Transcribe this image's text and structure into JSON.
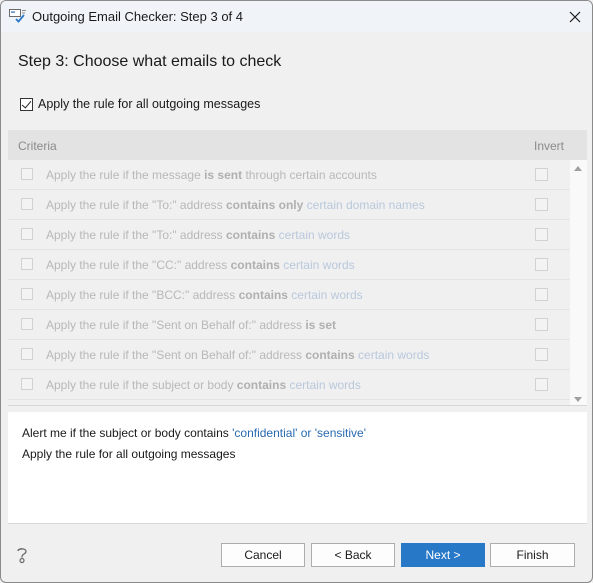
{
  "window": {
    "title": "Outgoing Email Checker: Step 3 of 4",
    "icon": "email-check-icon",
    "close_icon": "close-icon"
  },
  "step_heading": "Step 3: Choose what emails to check",
  "apply_all": {
    "label": "Apply the rule for all outgoing messages",
    "checked": true
  },
  "grid": {
    "columns": {
      "criteria": "Criteria",
      "invert": "Invert"
    },
    "rows": [
      {
        "parts": [
          {
            "t": "Apply the rule if the message ",
            "s": "normal"
          },
          {
            "t": "is sent",
            "s": "bold"
          },
          {
            "t": " through certain accounts",
            "s": "normal"
          }
        ],
        "checked": false,
        "invert": false,
        "enabled": false
      },
      {
        "parts": [
          {
            "t": "Apply the rule if the \"To:\" address ",
            "s": "normal"
          },
          {
            "t": "contains only",
            "s": "bold"
          },
          {
            "t": " ",
            "s": "normal"
          },
          {
            "t": "certain domain names",
            "s": "link"
          }
        ],
        "checked": false,
        "invert": false,
        "enabled": false
      },
      {
        "parts": [
          {
            "t": "Apply the rule if the \"To:\" address ",
            "s": "normal"
          },
          {
            "t": "contains",
            "s": "bold"
          },
          {
            "t": " ",
            "s": "normal"
          },
          {
            "t": "certain words",
            "s": "link"
          }
        ],
        "checked": false,
        "invert": false,
        "enabled": false
      },
      {
        "parts": [
          {
            "t": "Apply the rule if the \"CC:\" address ",
            "s": "normal"
          },
          {
            "t": "contains",
            "s": "bold"
          },
          {
            "t": " ",
            "s": "normal"
          },
          {
            "t": "certain words",
            "s": "link"
          }
        ],
        "checked": false,
        "invert": false,
        "enabled": false
      },
      {
        "parts": [
          {
            "t": "Apply the rule if the \"BCC:\" address ",
            "s": "normal"
          },
          {
            "t": "contains",
            "s": "bold"
          },
          {
            "t": " ",
            "s": "normal"
          },
          {
            "t": "certain words",
            "s": "link"
          }
        ],
        "checked": false,
        "invert": false,
        "enabled": false
      },
      {
        "parts": [
          {
            "t": "Apply the rule if the \"Sent on Behalf of:\" address ",
            "s": "normal"
          },
          {
            "t": "is set",
            "s": "bold"
          }
        ],
        "checked": false,
        "invert": false,
        "enabled": false
      },
      {
        "parts": [
          {
            "t": "Apply the rule if the \"Sent on Behalf of:\" address ",
            "s": "normal"
          },
          {
            "t": "contains",
            "s": "bold"
          },
          {
            "t": " ",
            "s": "normal"
          },
          {
            "t": "certain words",
            "s": "link"
          }
        ],
        "checked": false,
        "invert": false,
        "enabled": false
      },
      {
        "parts": [
          {
            "t": "Apply the rule if the subject or body ",
            "s": "normal"
          },
          {
            "t": "contains",
            "s": "bold"
          },
          {
            "t": " ",
            "s": "normal"
          },
          {
            "t": "certain words",
            "s": "link"
          }
        ],
        "checked": false,
        "invert": false,
        "enabled": false
      }
    ]
  },
  "summary": {
    "lines": [
      [
        {
          "t": "Alert me if the subject or body contains ",
          "s": "normal"
        },
        {
          "t": "'confidential' or 'sensitive'",
          "s": "link"
        }
      ],
      [
        {
          "t": "Apply the rule for all outgoing messages",
          "s": "normal"
        }
      ]
    ]
  },
  "footer": {
    "help_icon": "help-icon",
    "cancel_label": "Cancel",
    "back_label": "< Back",
    "next_label": "Next >",
    "finish_label": "Finish"
  },
  "colors": {
    "primary_button": "#2878c8",
    "link": "#2a6ab0",
    "disabled_link": "#b9c8dc",
    "titlebar": "#f0f4f9"
  }
}
